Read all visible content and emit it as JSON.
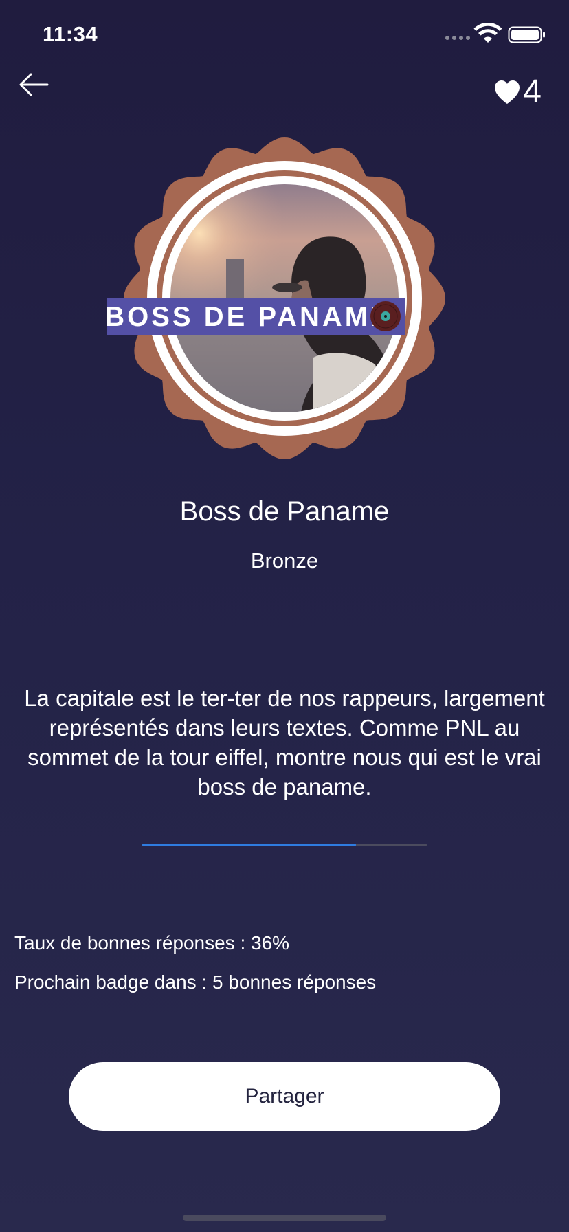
{
  "status_bar": {
    "time": "11:34"
  },
  "header": {
    "back_icon": "arrow-left-icon",
    "lives_icon": "heart-icon",
    "lives_count": "4"
  },
  "badge": {
    "banner_text": "BOSS DE PANAME",
    "title": "Boss de Paname",
    "level": "Bronze",
    "ring_color": "#a66852",
    "banner_color": "#5450a6",
    "description": "La capitale est le ter-ter de nos rappeurs, largement représentés dans leurs textes. Comme PNL au sommet de la tour eiffel, montre nous qui est le vrai boss de paname."
  },
  "progress": {
    "fraction": 0.75,
    "fill_color": "#2f7ce0",
    "track_color": "#4b4b5e"
  },
  "stats": {
    "success_rate": "Taux de bonnes réponses : 36%",
    "next_badge": "Prochain badge dans : 5 bonnes réponses"
  },
  "share_button": {
    "label": "Partager"
  },
  "colors": {
    "background_top": "#201c3f",
    "background_bottom": "#29294d",
    "text": "#ffffff",
    "button_text": "#24243f"
  }
}
